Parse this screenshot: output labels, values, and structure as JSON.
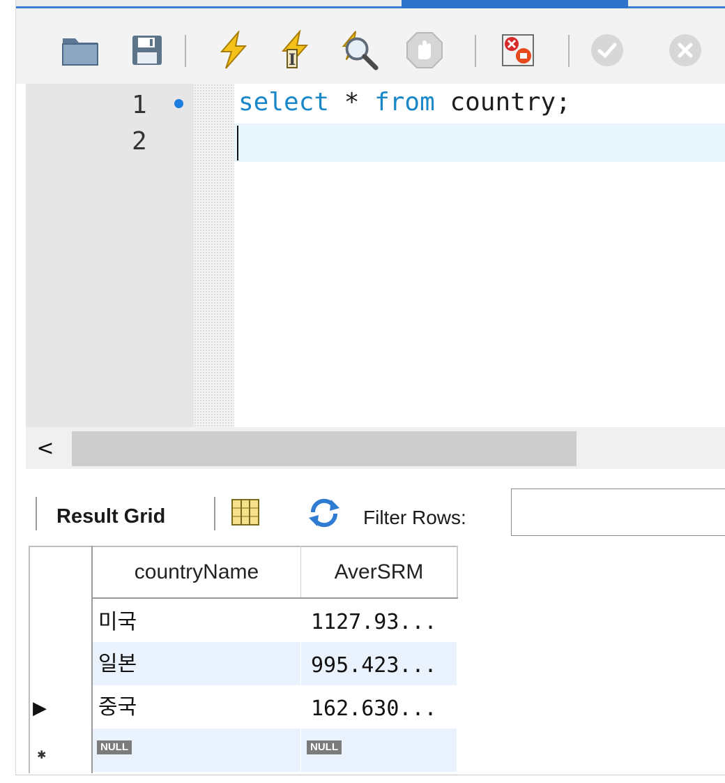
{
  "colors": {
    "accent": "#2d73c9",
    "keyword": "#1a87c8",
    "current_line": "#e9f6fd",
    "alt_row": "#eaf2fd",
    "null_badge": "#7b7b7b"
  },
  "toolbar": {
    "icons": [
      "folder-icon",
      "save-icon",
      "execute-icon",
      "execute-current-icon",
      "explain-icon",
      "stop-icon",
      "toggle-error-icon",
      "commit-icon",
      "rollback-icon"
    ]
  },
  "editor": {
    "lines": [
      {
        "number": "1",
        "tokens": [
          {
            "text": "select",
            "kind": "keyword"
          },
          {
            "text": " * ",
            "kind": "plain"
          },
          {
            "text": "from",
            "kind": "keyword"
          },
          {
            "text": " country;",
            "kind": "plain"
          }
        ]
      },
      {
        "number": "2",
        "tokens": []
      }
    ],
    "line1_number": "1",
    "line2_number": "2",
    "kw_select": "select",
    "star": " * ",
    "kw_from": "from",
    "table": " country;"
  },
  "scrollbar": {
    "left_arrow": "<"
  },
  "result_toolbar": {
    "result_grid_label": "Result Grid",
    "filter_label": "Filter Rows:",
    "filter_value": ""
  },
  "grid": {
    "columns": [
      "countryName",
      "AverSRM"
    ],
    "rows": [
      {
        "marker": "",
        "countryName": "미국",
        "AverSRM": "1127.93..."
      },
      {
        "marker": "",
        "countryName": "일본",
        "AverSRM": "995.423..."
      },
      {
        "marker": "▶",
        "countryName": "중국",
        "AverSRM": "162.630..."
      },
      {
        "marker": "✱",
        "countryName": "NULL",
        "AverSRM": "NULL"
      }
    ]
  }
}
